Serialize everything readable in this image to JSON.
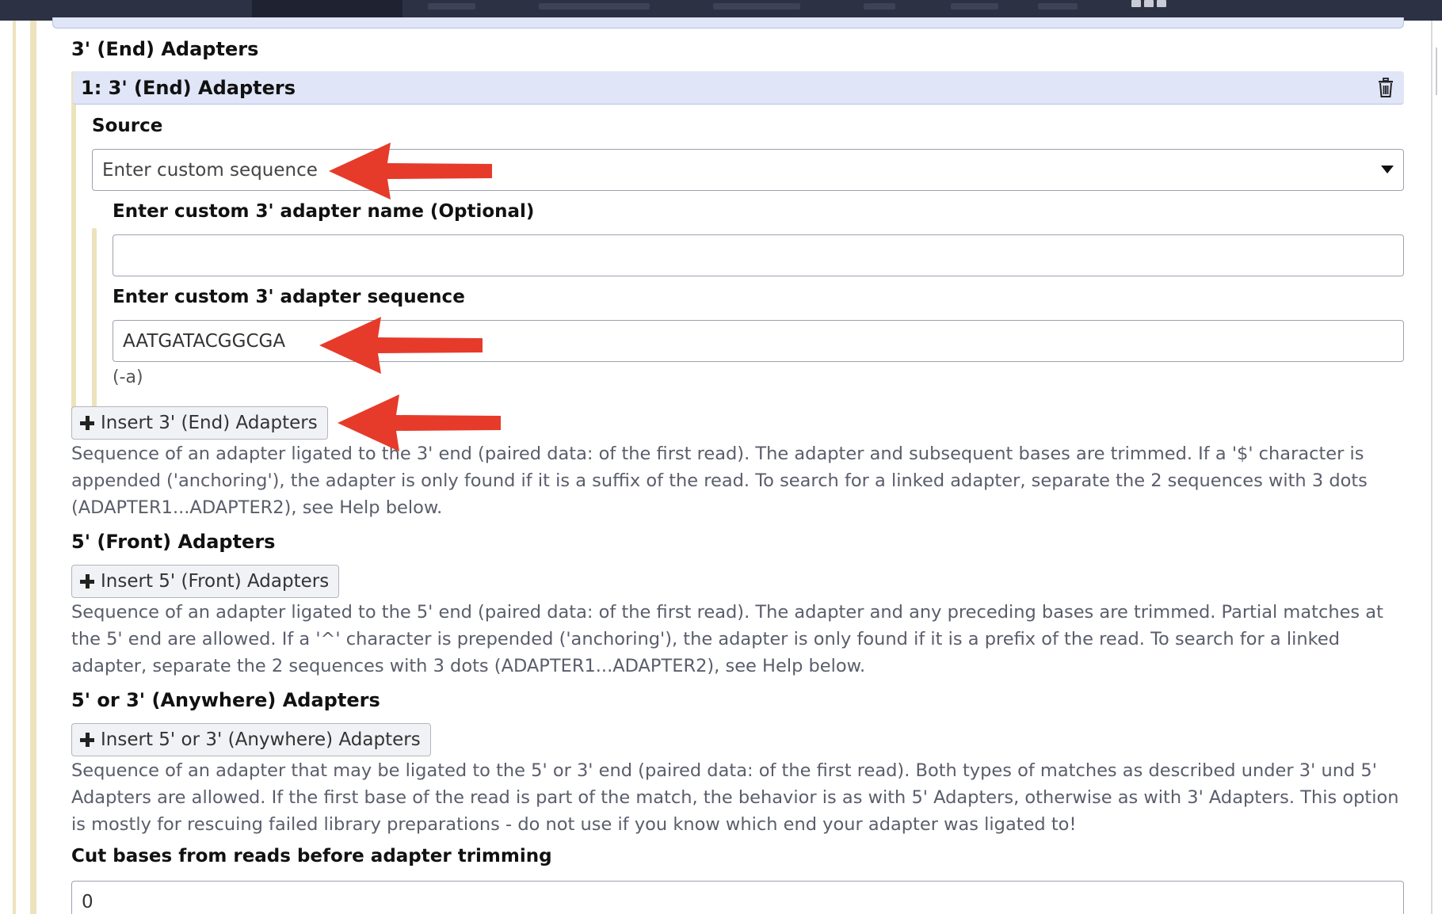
{
  "theme": {
    "arrow_color": "#e63b2a",
    "header_bg": "#e0e5f7",
    "accent_bar": "#ece3bd",
    "nav_bg": "#2c3143"
  },
  "three_prime": {
    "section_title": "3' (End) Adapters",
    "repeat_title": "1: 3' (End) Adapters",
    "delete_icon": "trash-icon",
    "source_label": "Source",
    "source_value": "Enter custom sequence",
    "name_label": "Enter custom 3' adapter name (Optional)",
    "name_value": "",
    "sequence_label": "Enter custom 3' adapter sequence",
    "sequence_value": "AATGATACGGCGA",
    "sequence_hint": "(-a)",
    "insert_label": "Insert 3' (End) Adapters",
    "help": "Sequence of an adapter ligated to the 3' end (paired data: of the first read). The adapter and subsequent bases are trimmed. If a '$' character is appended ('anchoring'), the adapter is only found if it is a suffix of the read. To search for a linked adapter, separate the 2 sequences with 3 dots (ADAPTER1...ADAPTER2), see Help below."
  },
  "five_prime": {
    "section_title": "5' (Front) Adapters",
    "insert_label": "Insert 5' (Front) Adapters",
    "help": "Sequence of an adapter ligated to the 5' end (paired data: of the first read). The adapter and any preceding bases are trimmed. Partial matches at the 5' end are allowed. If a '^' character is prepended ('anchoring'), the adapter is only found if it is a prefix of the read. To search for a linked adapter, separate the 2 sequences with 3 dots (ADAPTER1...ADAPTER2), see Help below."
  },
  "anywhere": {
    "section_title": "5' or 3' (Anywhere) Adapters",
    "insert_label": "Insert 5' or 3' (Anywhere) Adapters",
    "help": "Sequence of an adapter that may be ligated to the 5' or 3' end (paired data: of the first read). Both types of matches as described under 3' und 5' Adapters are allowed. If the first base of the read is part of the match, the behavior is as with 5' Adapters, otherwise as with 3' Adapters. This option is mostly for rescuing failed library preparations - do not use if you know which end your adapter was ligated to!"
  },
  "cut_bases": {
    "label": "Cut bases from reads before adapter trimming",
    "value": "0"
  }
}
